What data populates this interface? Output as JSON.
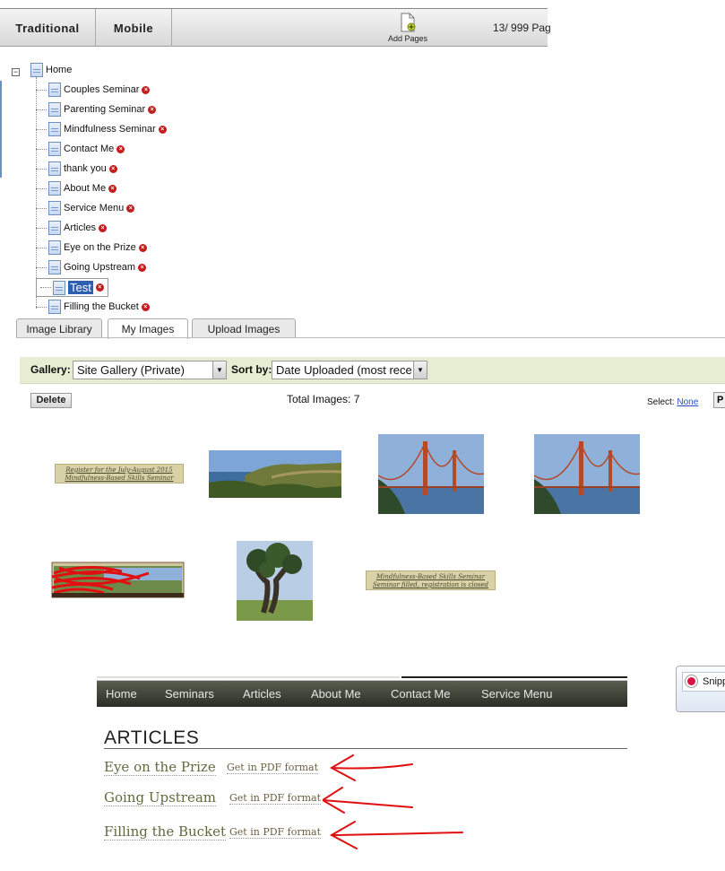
{
  "topbar": {
    "traditional": "Traditional",
    "mobile": "Mobile",
    "add_pages": "Add Pages",
    "page_count": "13/ 999 Pag"
  },
  "tree": {
    "root": "Home",
    "collapse_symbol": "−",
    "pages": [
      {
        "label": "Couples Seminar"
      },
      {
        "label": "Parenting Seminar"
      },
      {
        "label": "Mindfulness Seminar"
      },
      {
        "label": "Contact Me"
      },
      {
        "label": "thank you"
      },
      {
        "label": "About Me"
      },
      {
        "label": "Service Menu"
      },
      {
        "label": "Articles"
      },
      {
        "label": "Eye on the Prize"
      },
      {
        "label": "Going Upstream"
      },
      {
        "label": "Test",
        "selected": true
      },
      {
        "label": "Filling the Bucket"
      }
    ]
  },
  "tabs": [
    "Image Library",
    "My Images",
    "Upload Images"
  ],
  "active_tab": "My Images",
  "gallery": {
    "gallery_label": "Gallery:",
    "gallery_value": "Site Gallery (Private)",
    "sort_label": "Sort by:",
    "sort_value": "Date Uploaded (most rece",
    "delete_label": "Delete",
    "total_images": "Total Images: 7",
    "select_label": "Select:",
    "select_none": "None",
    "p_label": "P"
  },
  "thumbnails": {
    "banner1_line1": "Register for the July-August 2015",
    "banner1_line2": "Mindfulness-Based Skills Seminar",
    "banner2_line1": "Mindfulness-Based Skills Seminar",
    "banner2_line2": "Seminar filled, registration is closed"
  },
  "site": {
    "nav": [
      "Home",
      "Seminars",
      "Articles",
      "About Me",
      "Contact Me",
      "Service Menu"
    ],
    "heading": "ARTICLES",
    "articles": [
      {
        "title": "Eye on the Prize",
        "pdf": "Get in PDF format"
      },
      {
        "title": "Going Upstream",
        "pdf": "Get in PDF format"
      },
      {
        "title": "Filling the Bucket",
        "pdf": "Get in PDF format"
      }
    ]
  },
  "snippet": {
    "label": "Snipp"
  },
  "colors": {
    "accent_green": "#e6edd3",
    "nav_dark": "#2b2e25",
    "delete_red": "#c41b1b",
    "annotation_red": "#e01010"
  }
}
